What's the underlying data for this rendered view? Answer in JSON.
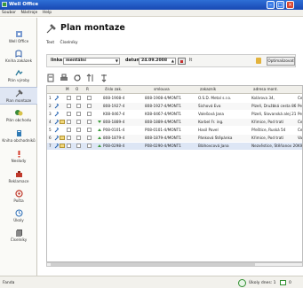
{
  "window": {
    "title": "Well Office"
  },
  "menu": [
    "Soubor",
    "Nástroje",
    "Help"
  ],
  "sidebar": [
    {
      "label": "Well Office",
      "icon": "well-office-icon"
    },
    {
      "label": "Kniha zakázek",
      "icon": "orders-book-icon"
    },
    {
      "label": "Plán výroby",
      "icon": "production-plan-icon"
    },
    {
      "label": "Plan montaze",
      "icon": "assembly-plan-icon",
      "active": true
    },
    {
      "label": "Plán obchodu",
      "icon": "sales-plan-icon"
    },
    {
      "label": "Kniha obchodníků",
      "icon": "dealers-book-icon"
    },
    {
      "label": "Nesłody",
      "icon": "issues-icon"
    },
    {
      "label": "Reklamace",
      "icon": "complaints-icon"
    },
    {
      "label": "Pošta",
      "icon": "mail-icon"
    },
    {
      "label": "Úkoly",
      "icon": "tasks-icon"
    },
    {
      "label": "Číselníky",
      "icon": "codebooks-icon"
    }
  ],
  "page": {
    "title": "Plan montaze"
  },
  "tabs": [
    "Text",
    "Číselníky"
  ],
  "filter": {
    "range_label": "linka",
    "range_value": "mentální",
    "date_label": "datum",
    "date_value": "24.09.2008",
    "extra_label": "It",
    "refresh_button": "Optimalizovat"
  },
  "table": {
    "columns": [
      "",
      "",
      "M",
      "O",
      "R",
      "",
      "číslo zak.",
      "smlouva",
      "zakazník",
      "adresa mont.",
      ""
    ],
    "rows": [
      {
        "n": "1",
        "cislo": "808-1908-4",
        "smlouva": "808-1908-4/MONT1",
        "zakaznik": "O.S.D. Metal s.r.o.",
        "adresa": "Kolárova 34,",
        "extra": "Česk",
        "flag": "",
        "mail": false
      },
      {
        "n": "2",
        "cislo": "808-1927-4",
        "smlouva": "808-1927-4/MONT1",
        "zakaznik": "Šichová Eva",
        "adresa": "Plzeň, Družbká cesta 86",
        "extra": "Petr",
        "flag": "",
        "mail": false
      },
      {
        "n": "3",
        "cislo": "K08-0467-4",
        "smlouva": "K08-0467-4/MONT1",
        "zakaznik": "Valešová Jana",
        "adresa": "Plzeň, Slovanská alej 21",
        "extra": "Petr",
        "flag": "",
        "mail": false
      },
      {
        "n": "4",
        "cislo": "808-1889-4",
        "smlouva": "808-1889-4/MONT1",
        "zakaznik": "Korbel Fr. ing.",
        "adresa": "Křimice, Pod tratí",
        "extra": "Česk",
        "flag": "down",
        "mail": true
      },
      {
        "n": "5",
        "cislo": "P08-0101-4",
        "smlouva": "P08-0101-4/MONT1",
        "zakaznik": "Hasil Pavel",
        "adresa": "Přeštice, Ruská 54",
        "extra": "Česk",
        "flag": "up",
        "mail": false
      },
      {
        "n": "6",
        "cislo": "808-1879-4",
        "smlouva": "808-1879-4/MONT1",
        "zakaznik": "Pánková Štěpánka",
        "adresa": "Křimice, Pod tratí",
        "extra": "Vace",
        "flag": "up",
        "mail": true
      },
      {
        "n": "7",
        "cislo": "P08-0298-4",
        "smlouva": "P08-0290-4/MONT1",
        "zakaznik": "Bláhovcová Jana",
        "adresa": "Nezvěstice, Štěňanov 20",
        "extra": "Klk Z",
        "flag": "up",
        "mail": true
      }
    ]
  },
  "status": {
    "left": "Fanda",
    "tasks": "Úkoly dnes: 1",
    "mail": "0"
  },
  "colors": {
    "titlebar": "#1f55c4",
    "sidebar_active": "#dfe6f3",
    "ok": "#2f8f2f"
  }
}
